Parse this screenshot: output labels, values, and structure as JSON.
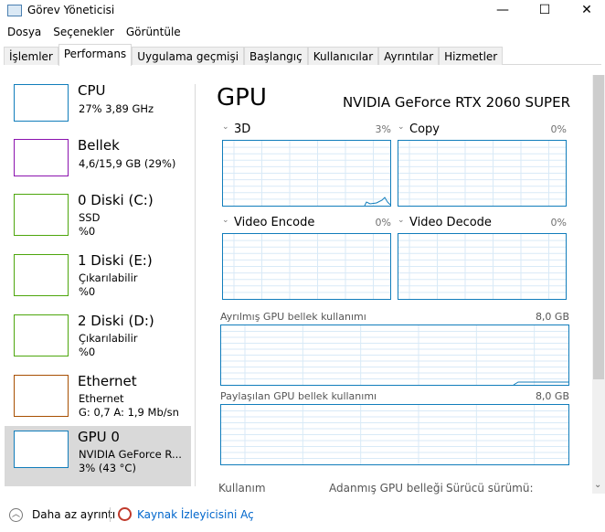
{
  "window": {
    "title": "Görev Yöneticisi",
    "minimize": "—",
    "maximize": "☐",
    "close": "✕"
  },
  "menu": [
    "Dosya",
    "Seçenekler",
    "Görüntüle"
  ],
  "tabs": [
    {
      "label": "İşlemler"
    },
    {
      "label": "Performans",
      "active": true
    },
    {
      "label": "Uygulama geçmişi"
    },
    {
      "label": "Başlangıç"
    },
    {
      "label": "Kullanıcılar"
    },
    {
      "label": "Ayrıntılar"
    },
    {
      "label": "Hizmetler"
    }
  ],
  "sidebar": [
    {
      "name": "CPU",
      "line1": "27% 3,89 GHz",
      "line2": "",
      "color": "#117dbb"
    },
    {
      "name": "Bellek",
      "line1": "4,6/15,9 GB (29%)",
      "line2": "",
      "color": "#8b12ae"
    },
    {
      "name": "0 Diski (C:)",
      "line1": "SSD",
      "line2": "%0",
      "color": "#4da60c"
    },
    {
      "name": "1 Diski (E:)",
      "line1": "Çıkarılabilir",
      "line2": "%0",
      "color": "#4da60c"
    },
    {
      "name": "2 Diski (D:)",
      "line1": "Çıkarılabilir",
      "line2": "%0",
      "color": "#4da60c"
    },
    {
      "name": "Ethernet",
      "line1": "Ethernet",
      "line2": "G: 0,7 A: 1,9 Mb/sn",
      "color": "#a74f01"
    },
    {
      "name": "GPU 0",
      "line1": "NVIDIA GeForce R...",
      "line2": "3%  (43 °C)",
      "color": "#117dbb",
      "selected": true
    }
  ],
  "main": {
    "title": "GPU",
    "model": "NVIDIA GeForce RTX 2060 SUPER",
    "engines": [
      {
        "label": "3D",
        "value": "3%"
      },
      {
        "label": "Copy",
        "value": "0%"
      },
      {
        "label": "Video Encode",
        "value": "0%"
      },
      {
        "label": "Video Decode",
        "value": "0%"
      }
    ],
    "dedicated": {
      "label": "Ayrılmış GPU bellek kullanımı",
      "max": "8,0 GB"
    },
    "shared": {
      "label": "Paylaşılan GPU bellek kullanımı",
      "max": "8,0 GB"
    },
    "stats": [
      "Kullanım",
      "Adanmış GPU belleği",
      "Sürücü sürümü:"
    ]
  },
  "footer": {
    "less_details": "Daha az ayrıntı",
    "resource_monitor": "Kaynak İzleyicisini Aç"
  },
  "colors": {
    "gpu": "#117dbb",
    "grid": "#d9eaf7",
    "selected": "#d9d9d9"
  }
}
